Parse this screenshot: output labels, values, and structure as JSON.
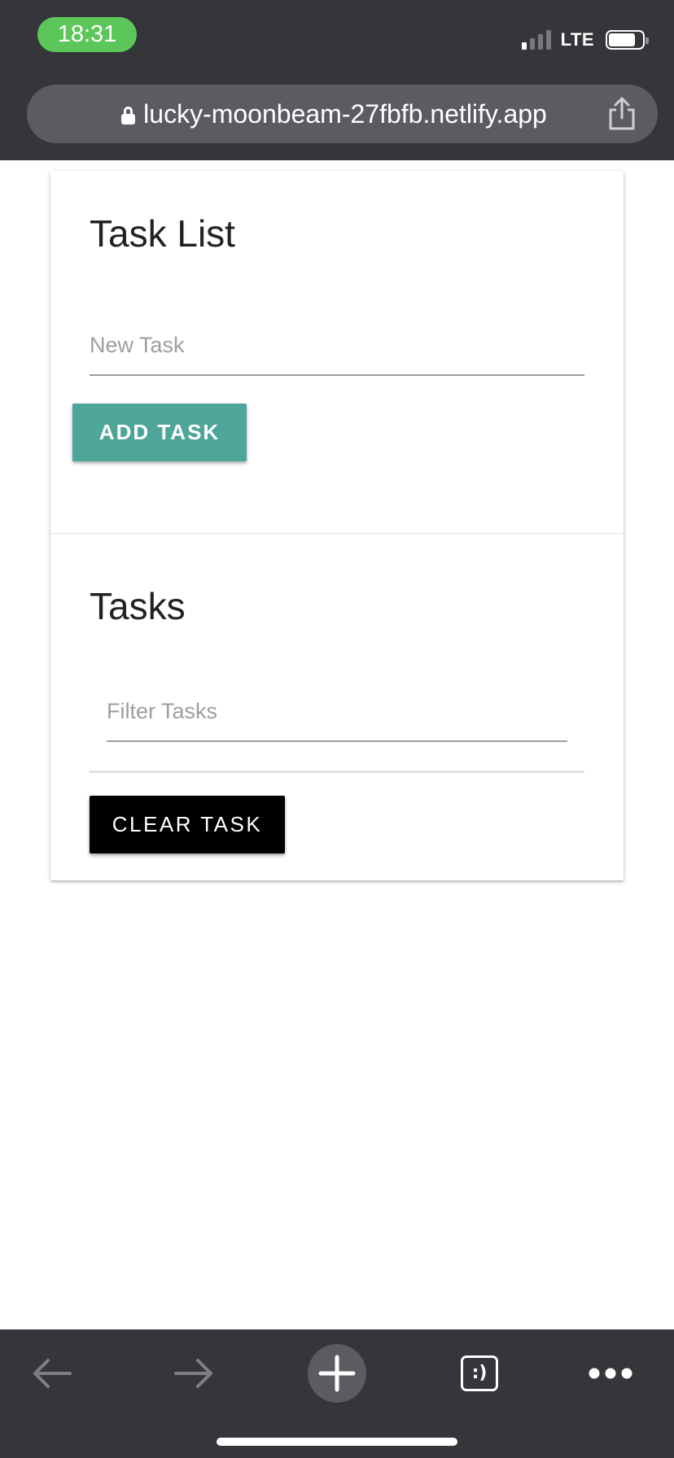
{
  "status_bar": {
    "time": "18:31",
    "network": "LTE",
    "signal_bars_active": 1,
    "signal_bars_total": 4,
    "battery_level": 0.8,
    "time_pill_color": "#5dc65b"
  },
  "browser": {
    "url": "lucky-moonbeam-27fbfb.netlify.app",
    "chrome_color": "#35363a",
    "url_bar_color": "#5a5c61"
  },
  "card": {
    "title": "Task List",
    "new_task_placeholder": "New Task",
    "add_button_label": "ADD TASK",
    "add_button_color": "#4ea69a",
    "tasks_title": "Tasks",
    "filter_placeholder": "Filter Tasks",
    "tasks": [],
    "clear_button_label": "CLEAR TASK",
    "clear_button_color": "#000000"
  },
  "toolbar": {
    "back_icon": "arrow-left-icon",
    "forward_icon": "arrow-right-icon",
    "new_tab_icon": "plus-icon",
    "tabs_label": ":)",
    "menu_icon": "more-horizontal-icon"
  }
}
